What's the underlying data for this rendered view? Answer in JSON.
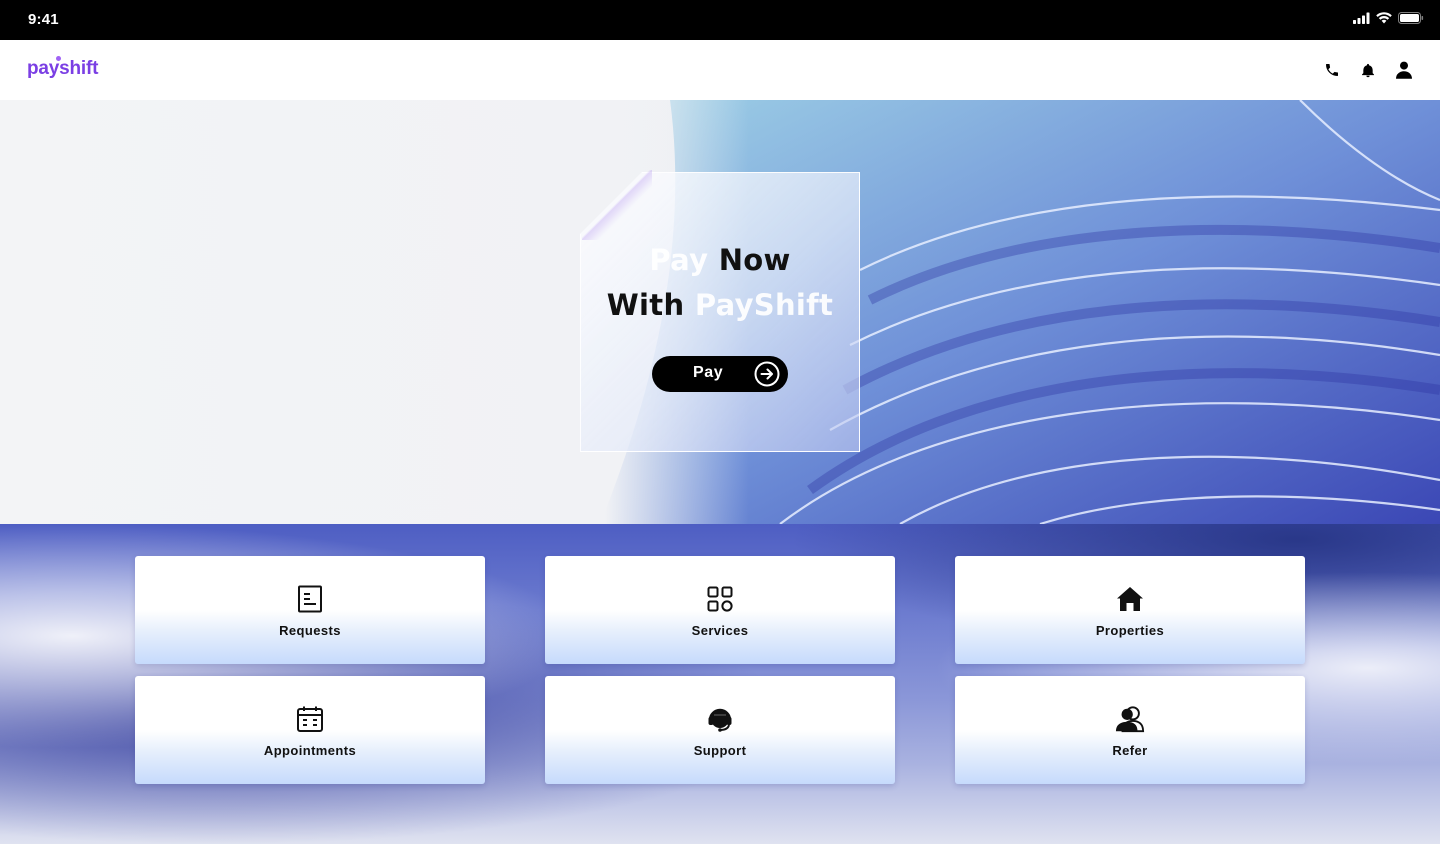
{
  "status_bar": {
    "time": "9:41",
    "icons": [
      "signal-icon",
      "wifi-icon",
      "battery-icon"
    ]
  },
  "navbar": {
    "brand": "payshift",
    "brand_color": "#7b3fe4",
    "icons": [
      "phone-icon",
      "bell-icon",
      "user-icon"
    ]
  },
  "hero": {
    "headline": {
      "line1_light": "Pay",
      "line1_dark": "Now",
      "line2_dark": "With",
      "line2_light": "PayShift"
    },
    "pay_button": {
      "label": "Pay",
      "icon": "arrow-right-circle-icon"
    }
  },
  "tiles": [
    {
      "label": "Requests",
      "icon": "document-icon"
    },
    {
      "label": "Services",
      "icon": "grid-icon"
    },
    {
      "label": "Properties",
      "icon": "home-icon"
    },
    {
      "label": "Appointments",
      "icon": "calendar-icon"
    },
    {
      "label": "Support",
      "icon": "headset-icon"
    },
    {
      "label": "Refer",
      "icon": "refer-user-icon"
    }
  ],
  "colors": {
    "accent": "#7b3fe4",
    "hero_blue": "#4452c4",
    "button": "#000000"
  }
}
